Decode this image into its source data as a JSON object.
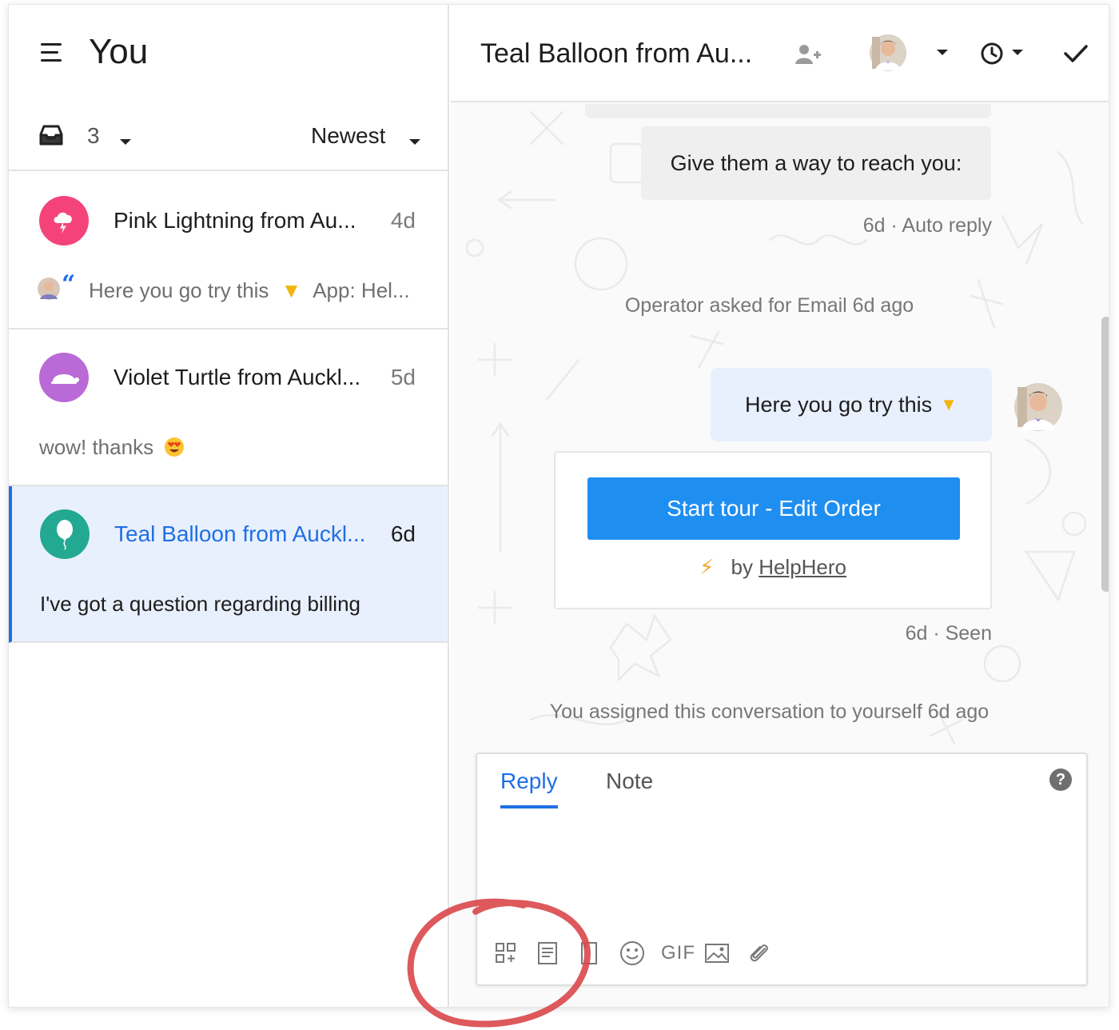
{
  "sidebar": {
    "title": "You",
    "inbox_count": "3",
    "sort_label": "Newest",
    "conversations": [
      {
        "name": "Pink Lightning from Au...",
        "time": "4d",
        "preview": "Here you go try this",
        "preview_suffix": "App: Hel...",
        "avatar_color": "#f4437a",
        "icon": "cloud-lightning-icon"
      },
      {
        "name": "Violet Turtle from Auckl...",
        "time": "5d",
        "preview": "wow! thanks",
        "avatar_color": "#b96ad6",
        "icon": "turtle-icon"
      },
      {
        "name": "Teal Balloon from Auckl...",
        "time": "6d",
        "preview": "I've got a question regarding billing",
        "avatar_color": "#23a991",
        "icon": "balloon-icon",
        "selected": true
      }
    ]
  },
  "header": {
    "title": "Teal Balloon from Au..."
  },
  "thread": {
    "auto_reply_text": "Give them a way to reach you:",
    "auto_reply_meta": "6d · Auto reply",
    "event_email": "Operator asked for Email 6d ago",
    "operator_message": "Here you go try this",
    "tour_button": "Start tour - Edit Order",
    "byline_prefix": "by",
    "byline_link": "HelpHero",
    "seen_meta": "6d · Seen",
    "event_assigned": "You assigned this conversation to yourself 6d ago"
  },
  "composer": {
    "tab_reply": "Reply",
    "tab_note": "Note",
    "help": "?",
    "gif_label": "GIF"
  },
  "colors": {
    "accent": "#1f6fe5",
    "tour_button": "#1f8ef1",
    "annotation": "#d9474a",
    "selected_bg": "#e9f0fd"
  }
}
